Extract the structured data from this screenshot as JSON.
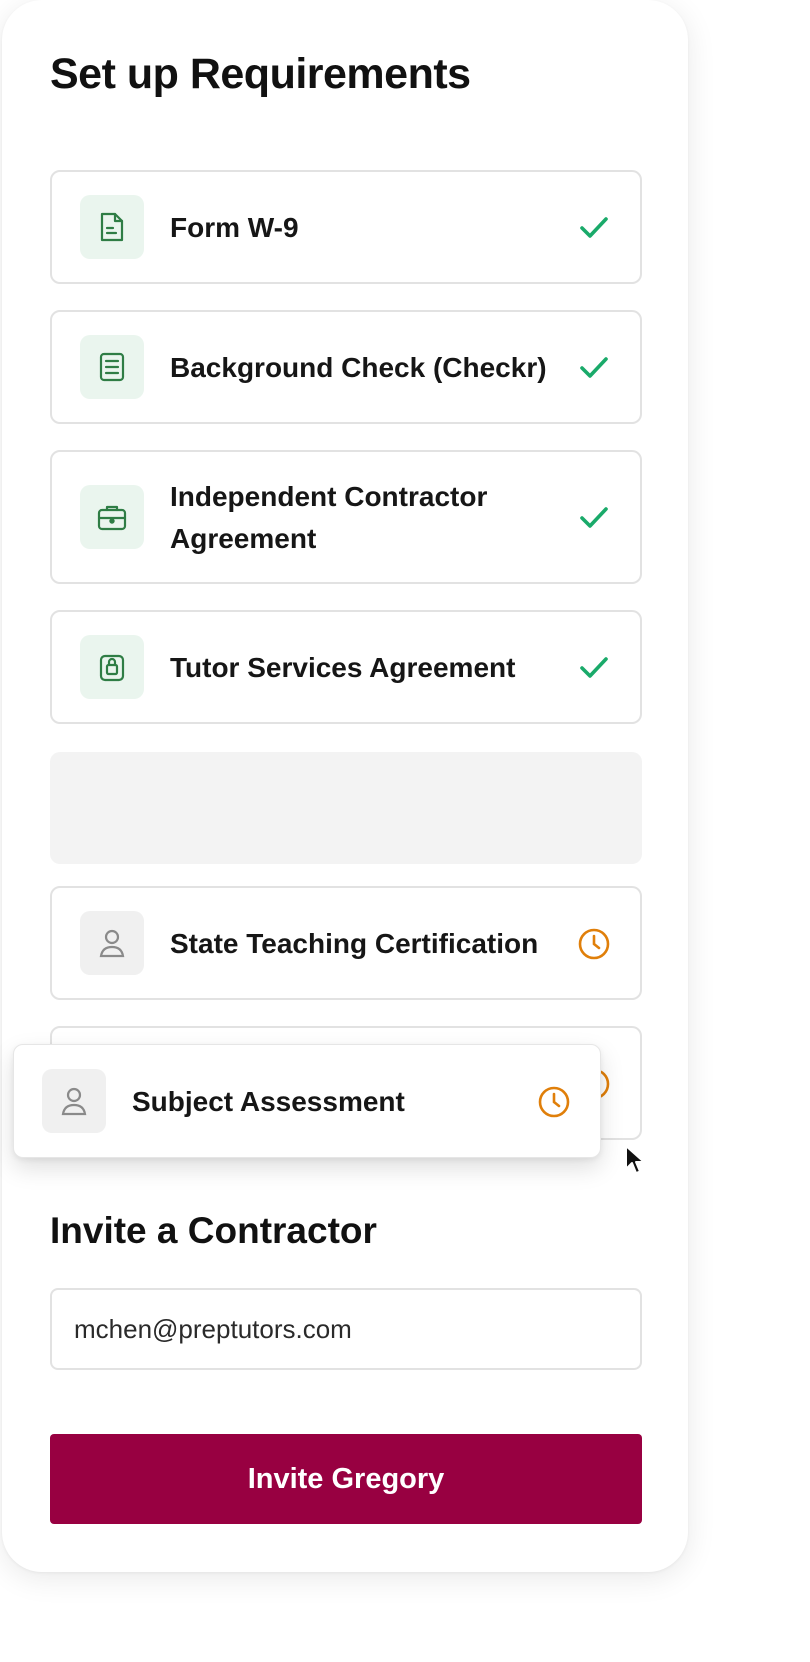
{
  "page": {
    "title": "Set up Requirements"
  },
  "requirements": [
    {
      "label": "Form W-9",
      "icon": "document-icon",
      "status": "complete",
      "status_icon": "check-icon"
    },
    {
      "label": "Background Check (Checkr)",
      "icon": "list-document-icon",
      "status": "complete",
      "status_icon": "check-icon"
    },
    {
      "label_line1": "Independent Contractor",
      "label_line2": "Agreement",
      "icon": "briefcase-icon",
      "status": "complete",
      "status_icon": "check-icon"
    },
    {
      "label": "Tutor Services Agreement",
      "icon": "lock-document-icon",
      "status": "complete",
      "status_icon": "check-icon"
    },
    {
      "label": "State Teaching Certification",
      "icon": "person-icon",
      "status": "pending",
      "status_icon": "clock-icon"
    }
  ],
  "dragging": {
    "label": "Subject Assessment",
    "icon": "person-icon",
    "status": "pending",
    "status_icon": "clock-icon"
  },
  "invite": {
    "heading": "Invite a Contractor",
    "email_value": "mchen@preptutors.com",
    "button_label": "Invite Gregory"
  },
  "colors": {
    "brand": "#980041",
    "check": "#1aaa6a",
    "pending": "#e07f0a",
    "icon_green": "#2f7d45",
    "icon_grey": "#8a8a8a"
  }
}
